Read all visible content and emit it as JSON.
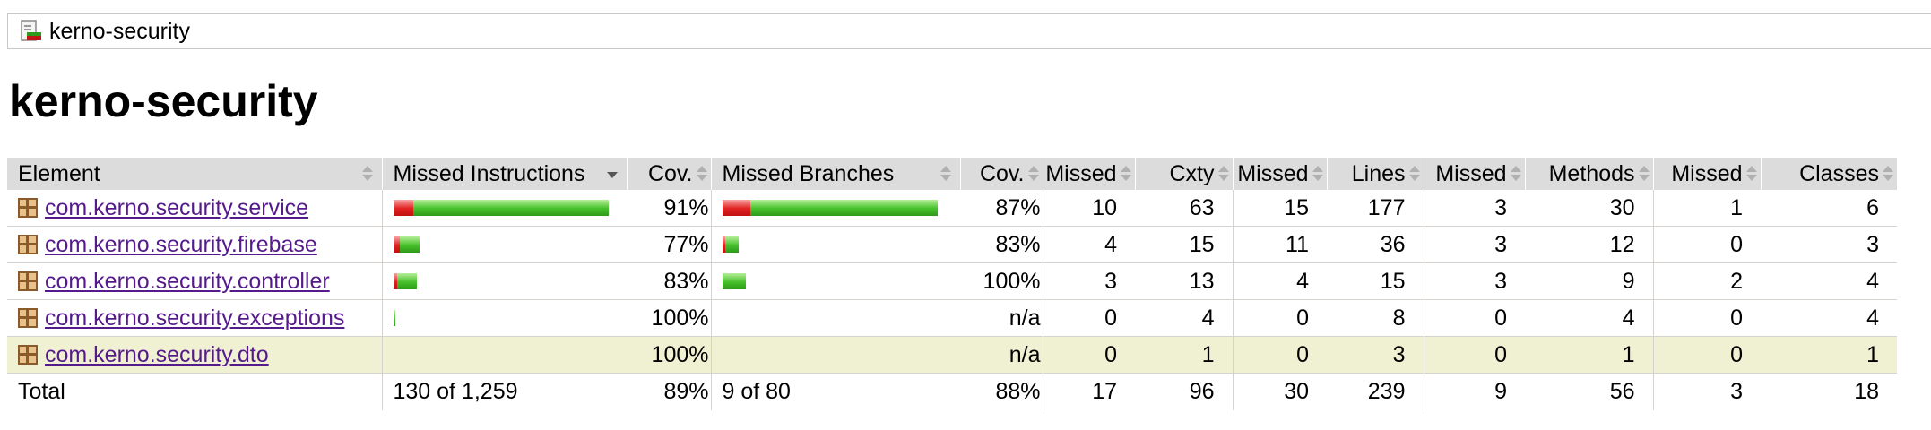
{
  "breadcrumb": {
    "label": "kerno-security",
    "icon": "report-icon"
  },
  "title": "kerno-security",
  "columns": [
    "Element",
    "Missed Instructions",
    "Cov.",
    "Missed Branches",
    "Cov.",
    "Missed",
    "Cxty",
    "Missed",
    "Lines",
    "Missed",
    "Methods",
    "Missed",
    "Classes"
  ],
  "colors": {
    "header_bg": "#dcdcdc",
    "highlight_row": "#f0f0d2",
    "bar_red": "#e02020",
    "bar_green": "#45c02a",
    "link": "#551a8b"
  },
  "rows": [
    {
      "name": "com.kerno.security.service",
      "instr_bar": {
        "missed": 0.09,
        "covered": 0.91,
        "scale": 1.0
      },
      "instr_cov": "91%",
      "branch_bar": {
        "missed": 0.13,
        "covered": 0.87,
        "scale": 1.0
      },
      "branch_cov": "87%",
      "cxty_missed": "10",
      "cxty": "63",
      "lines_missed": "15",
      "lines": "177",
      "methods_missed": "3",
      "methods": "30",
      "classes_missed": "1",
      "classes": "6"
    },
    {
      "name": "com.kerno.security.firebase",
      "instr_bar": {
        "missed": 0.23,
        "covered": 0.77,
        "scale": 0.12
      },
      "instr_cov": "77%",
      "branch_bar": {
        "missed": 0.17,
        "covered": 0.83,
        "scale": 0.075
      },
      "branch_cov": "83%",
      "cxty_missed": "4",
      "cxty": "15",
      "lines_missed": "11",
      "lines": "36",
      "methods_missed": "3",
      "methods": "12",
      "classes_missed": "0",
      "classes": "3"
    },
    {
      "name": "com.kerno.security.controller",
      "instr_bar": {
        "missed": 0.17,
        "covered": 0.83,
        "scale": 0.11
      },
      "instr_cov": "83%",
      "branch_bar": {
        "missed": 0.0,
        "covered": 1.0,
        "scale": 0.11
      },
      "branch_cov": "100%",
      "cxty_missed": "3",
      "cxty": "13",
      "lines_missed": "4",
      "lines": "15",
      "methods_missed": "3",
      "methods": "9",
      "classes_missed": "2",
      "classes": "4"
    },
    {
      "name": "com.kerno.security.exceptions",
      "instr_bar": {
        "missed": 0.0,
        "covered": 1.0,
        "scale": 0.01
      },
      "instr_cov": "100%",
      "branch_bar": null,
      "branch_cov": "n/a",
      "cxty_missed": "0",
      "cxty": "4",
      "lines_missed": "0",
      "lines": "8",
      "methods_missed": "0",
      "methods": "4",
      "classes_missed": "0",
      "classes": "4"
    },
    {
      "name": "com.kerno.security.dto",
      "instr_bar": null,
      "instr_cov": "100%",
      "branch_bar": null,
      "branch_cov": "n/a",
      "cxty_missed": "0",
      "cxty": "1",
      "lines_missed": "0",
      "lines": "3",
      "methods_missed": "0",
      "methods": "1",
      "classes_missed": "0",
      "classes": "1",
      "highlighted": true
    }
  ],
  "total": {
    "label": "Total",
    "instr": "130 of 1,259",
    "instr_cov": "89%",
    "branch": "9 of 80",
    "branch_cov": "88%",
    "cxty_missed": "17",
    "cxty": "96",
    "lines_missed": "30",
    "lines": "239",
    "methods_missed": "9",
    "methods": "56",
    "classes_missed": "3",
    "classes": "18"
  }
}
